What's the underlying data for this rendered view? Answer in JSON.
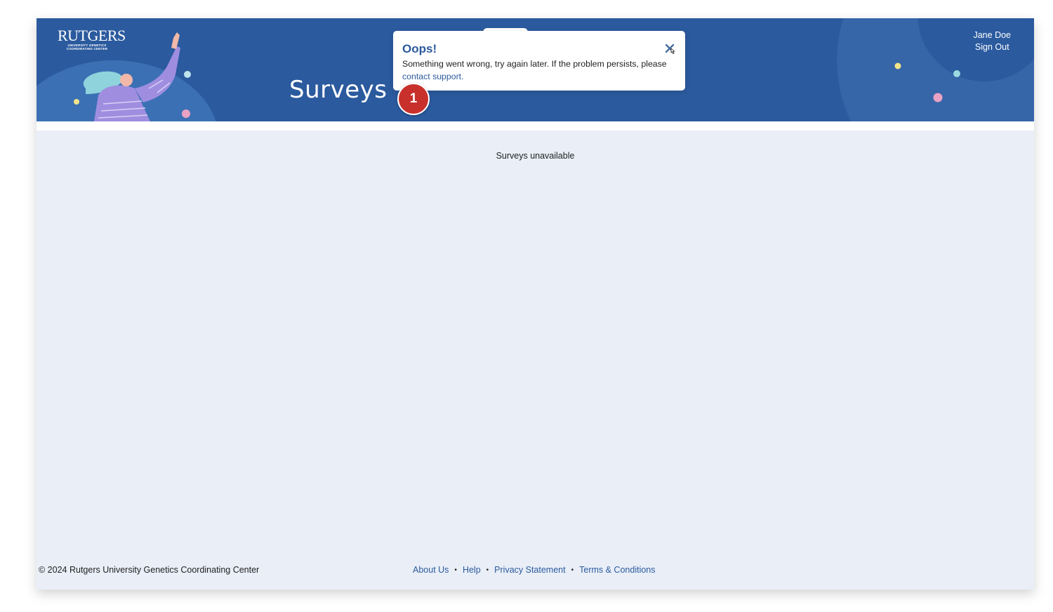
{
  "header": {
    "logo": {
      "wordmark": "RUTGERS",
      "subtitle_line1": "UNIVERSITY GENETICS",
      "subtitle_line2": "COORDINATING CENTER"
    },
    "title": "Surveys",
    "user": {
      "name": "Jane Doe",
      "sign_out_label": "Sign Out"
    }
  },
  "main": {
    "status_message": "Surveys unavailable"
  },
  "toast": {
    "title": "Oops!",
    "message": "Something went wrong, try again later. If the problem persists, please",
    "link_label": "contact support.",
    "close_icon": "close-icon"
  },
  "annotation": {
    "step_number": "1"
  },
  "footer": {
    "copyright": "© 2024 Rutgers University Genetics Coordinating Center",
    "links": [
      "About Us",
      "Help",
      "Privacy Statement",
      "Terms & Conditions"
    ],
    "separator": "•"
  },
  "colors": {
    "brand_blue": "#2b5a9e",
    "page_bg": "#e9eef7",
    "badge_red": "#c8302c"
  }
}
